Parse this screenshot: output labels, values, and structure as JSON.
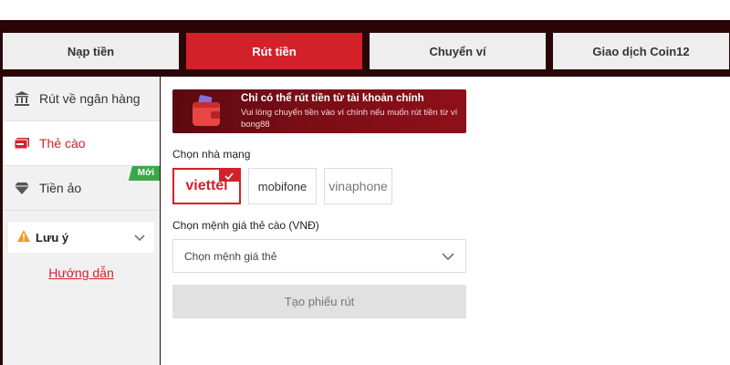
{
  "tabs": [
    {
      "label": "Nạp tiền"
    },
    {
      "label": "Rút tiền"
    },
    {
      "label": "Chuyển ví"
    },
    {
      "label": "Giao dịch Coin12"
    }
  ],
  "sidebar": {
    "items": [
      {
        "label": "Rút về ngân hàng",
        "icon": "bank-icon"
      },
      {
        "label": "Thẻ cào",
        "icon": "card-icon"
      },
      {
        "label": "Tiền ảo",
        "icon": "diamond-icon",
        "badge": "Mới"
      }
    ],
    "note_label": "Lưu ý",
    "guide_label": "Hướng dẫn"
  },
  "banner": {
    "title": "Chỉ có thể rút tiền từ tài khoản chính",
    "desc": "Vui lòng chuyển tiền vào ví chính nếu muốn rút tiền từ ví bong88"
  },
  "form": {
    "carrier_label": "Chọn nhà mạng",
    "carriers": [
      "viettel",
      "mobifone",
      "vinaphone"
    ],
    "amount_label": "Chọn mệnh giá thẻ cào (VNĐ)",
    "amount_placeholder": "Chọn mệnh giá thẻ",
    "submit_label": "Tạo phiếu rút"
  },
  "colors": {
    "accent": "#d3212a",
    "new_badge": "#3aa84a",
    "frame": "#2a0508"
  }
}
